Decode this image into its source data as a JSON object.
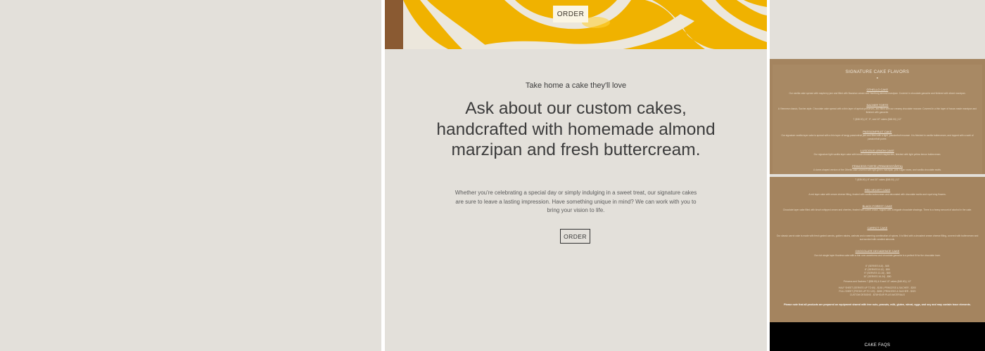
{
  "hero": {
    "order_label": "ORDER",
    "colors": {
      "yellow": "#f1b800",
      "cream": "#ece7dc",
      "frame": "#8a5a32"
    }
  },
  "custom": {
    "subtitle": "Take home a cake they'll love",
    "headline": "Ask about our custom cakes, handcrafted with homemade almond marzipan and fresh buttercream.",
    "paragraph": "Whether you're celebrating a special day or simply indulging in a sweet treat, our signature cakes are sure to leave a lasting impression. Have something unique in mind? We can work with you to bring your vision to life.",
    "order_label": "ORDER"
  },
  "menu": {
    "title": "SIGNATURE CAKE FLAVORS",
    "items": [
      {
        "name": "OTHELLO CAKE",
        "desc": "Our vanilla cake spread with raspberry jam and filled with Bavarian cream and Hamburg almond marzipan. Covered in chocolate ganache and finished with sliced marzipan."
      },
      {
        "name": "SACHER TORTE",
        "desc": "A Viennese classic, Sacher-style. Chocolate cake spread with a thin layer of apricot preserves, and filled with our creamy chocolate mousse. Covered in a thin layer of house-made marzipan and finished with ganache.",
        "price": "7 ($38.00) | 8\", 9\", and 10\" cakes ($48.00) | 12\""
      },
      {
        "name": "PASSIONFRUIT CAKE",
        "desc": "Our signature vanilla layer cake is spread with a thin layer of tangy passionfruit jam and filled with a light, passionfruit mousse. It is finished in vanilla buttercream, and topped with a swirl of passionfruit puree."
      },
      {
        "name": "LUSCIOUS LEMON CAKE",
        "desc": "Our signature light vanilla layer cake with lemon mousse and fresh raspberries, finished with light yellow lemon buttercream."
      },
      {
        "name": "PRINCESS TORTE (PRINSESSTÅRTA)",
        "desc": "A dome-shaped version of the Othello cake covered with light green marzipan, pink sugar roses, and vanilla chocolate swirls.",
        "price": "7 ($38.00) | 8\" and 10\" cakes ($48.00) | 12\""
      },
      {
        "name": "RED VELVET CAKE",
        "desc": "A red layer cake with cream cheese filling, frosted with vanilla buttercream and decorated with chocolate swirls and royal icing flowers."
      },
      {
        "name": "BLACK FOREST CAKE",
        "desc": "Chocolate layer cake filled with kirsch whipped cream and cherries, frosted with sweet cream, topped with a brigade chocolate shavings. There is a heavy amount of alcohol in the cake."
      },
      {
        "name": "CARROT CAKE",
        "desc": "Our classic carrot cake is made with fresh grated carrots, golden raisins, walnuts and a warming combination of spices. It is filled with a decadent cream cheese filling, covered with buttercream and surrounded with candied almonds."
      },
      {
        "name": "CHOCOLATE DECADENCE CAKE",
        "desc": "Our rich single layer flourless cake with a thin over-sweetness and chocolate ganache is a perfect fit for the chocolate lover."
      }
    ],
    "prices": [
      "6\" (SERVES 6-8) - $45",
      "8\" (SERVES 8-12) - $55",
      "9\" (SERVES 12-16) - $65",
      "10\" (SERVES 16-24) - $80",
      "Princess and Sachers 7 ($38.00) & 8 and 10\" cakes ($48.00) | 12\"",
      "HALF SHEET (SERVES UP TO 60) - $150 | PRINCESS & SACHER - $200",
      "FULL SHEET (FEEDS UP TO 120) - $285 | PRINCESS & SACHER - $320",
      "CUSTOM DESIGNS - $75/HOUR PLUS MATERIALS"
    ],
    "notice": "Please note that all products are prepared on equipment shared with tree nuts, peanuts, milk, gluten, wheat, eggs, and soy and may contain trace elements.",
    "panel_color": "#a4845f"
  },
  "faq": {
    "title": "CAKE FAQS"
  }
}
